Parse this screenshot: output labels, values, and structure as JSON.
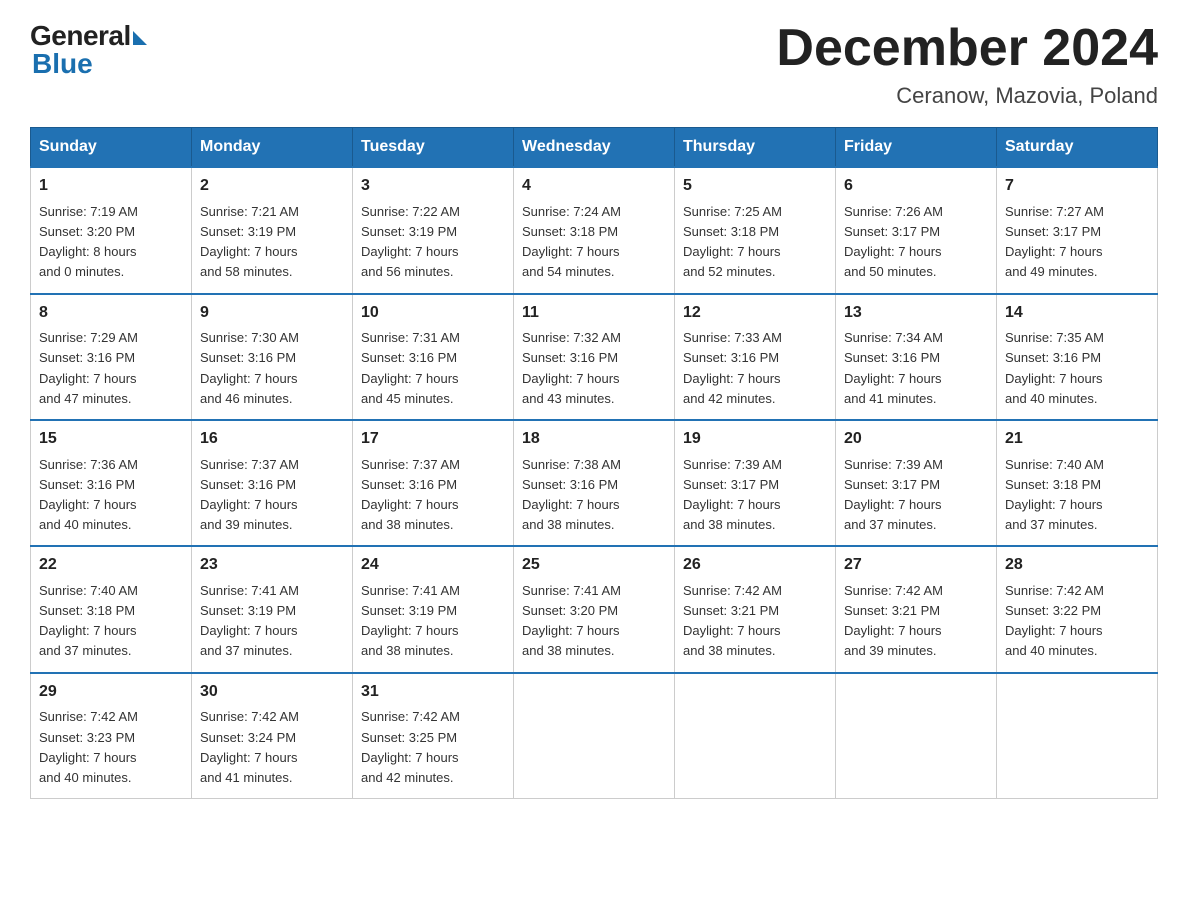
{
  "logo": {
    "general": "General",
    "blue": "Blue"
  },
  "title": "December 2024",
  "subtitle": "Ceranow, Mazovia, Poland",
  "weekdays": [
    "Sunday",
    "Monday",
    "Tuesday",
    "Wednesday",
    "Thursday",
    "Friday",
    "Saturday"
  ],
  "weeks": [
    [
      {
        "day": "1",
        "sunrise": "7:19 AM",
        "sunset": "3:20 PM",
        "daylight": "8 hours and 0 minutes."
      },
      {
        "day": "2",
        "sunrise": "7:21 AM",
        "sunset": "3:19 PM",
        "daylight": "7 hours and 58 minutes."
      },
      {
        "day": "3",
        "sunrise": "7:22 AM",
        "sunset": "3:19 PM",
        "daylight": "7 hours and 56 minutes."
      },
      {
        "day": "4",
        "sunrise": "7:24 AM",
        "sunset": "3:18 PM",
        "daylight": "7 hours and 54 minutes."
      },
      {
        "day": "5",
        "sunrise": "7:25 AM",
        "sunset": "3:18 PM",
        "daylight": "7 hours and 52 minutes."
      },
      {
        "day": "6",
        "sunrise": "7:26 AM",
        "sunset": "3:17 PM",
        "daylight": "7 hours and 50 minutes."
      },
      {
        "day": "7",
        "sunrise": "7:27 AM",
        "sunset": "3:17 PM",
        "daylight": "7 hours and 49 minutes."
      }
    ],
    [
      {
        "day": "8",
        "sunrise": "7:29 AM",
        "sunset": "3:16 PM",
        "daylight": "7 hours and 47 minutes."
      },
      {
        "day": "9",
        "sunrise": "7:30 AM",
        "sunset": "3:16 PM",
        "daylight": "7 hours and 46 minutes."
      },
      {
        "day": "10",
        "sunrise": "7:31 AM",
        "sunset": "3:16 PM",
        "daylight": "7 hours and 45 minutes."
      },
      {
        "day": "11",
        "sunrise": "7:32 AM",
        "sunset": "3:16 PM",
        "daylight": "7 hours and 43 minutes."
      },
      {
        "day": "12",
        "sunrise": "7:33 AM",
        "sunset": "3:16 PM",
        "daylight": "7 hours and 42 minutes."
      },
      {
        "day": "13",
        "sunrise": "7:34 AM",
        "sunset": "3:16 PM",
        "daylight": "7 hours and 41 minutes."
      },
      {
        "day": "14",
        "sunrise": "7:35 AM",
        "sunset": "3:16 PM",
        "daylight": "7 hours and 40 minutes."
      }
    ],
    [
      {
        "day": "15",
        "sunrise": "7:36 AM",
        "sunset": "3:16 PM",
        "daylight": "7 hours and 40 minutes."
      },
      {
        "day": "16",
        "sunrise": "7:37 AM",
        "sunset": "3:16 PM",
        "daylight": "7 hours and 39 minutes."
      },
      {
        "day": "17",
        "sunrise": "7:37 AM",
        "sunset": "3:16 PM",
        "daylight": "7 hours and 38 minutes."
      },
      {
        "day": "18",
        "sunrise": "7:38 AM",
        "sunset": "3:16 PM",
        "daylight": "7 hours and 38 minutes."
      },
      {
        "day": "19",
        "sunrise": "7:39 AM",
        "sunset": "3:17 PM",
        "daylight": "7 hours and 38 minutes."
      },
      {
        "day": "20",
        "sunrise": "7:39 AM",
        "sunset": "3:17 PM",
        "daylight": "7 hours and 37 minutes."
      },
      {
        "day": "21",
        "sunrise": "7:40 AM",
        "sunset": "3:18 PM",
        "daylight": "7 hours and 37 minutes."
      }
    ],
    [
      {
        "day": "22",
        "sunrise": "7:40 AM",
        "sunset": "3:18 PM",
        "daylight": "7 hours and 37 minutes."
      },
      {
        "day": "23",
        "sunrise": "7:41 AM",
        "sunset": "3:19 PM",
        "daylight": "7 hours and 37 minutes."
      },
      {
        "day": "24",
        "sunrise": "7:41 AM",
        "sunset": "3:19 PM",
        "daylight": "7 hours and 38 minutes."
      },
      {
        "day": "25",
        "sunrise": "7:41 AM",
        "sunset": "3:20 PM",
        "daylight": "7 hours and 38 minutes."
      },
      {
        "day": "26",
        "sunrise": "7:42 AM",
        "sunset": "3:21 PM",
        "daylight": "7 hours and 38 minutes."
      },
      {
        "day": "27",
        "sunrise": "7:42 AM",
        "sunset": "3:21 PM",
        "daylight": "7 hours and 39 minutes."
      },
      {
        "day": "28",
        "sunrise": "7:42 AM",
        "sunset": "3:22 PM",
        "daylight": "7 hours and 40 minutes."
      }
    ],
    [
      {
        "day": "29",
        "sunrise": "7:42 AM",
        "sunset": "3:23 PM",
        "daylight": "7 hours and 40 minutes."
      },
      {
        "day": "30",
        "sunrise": "7:42 AM",
        "sunset": "3:24 PM",
        "daylight": "7 hours and 41 minutes."
      },
      {
        "day": "31",
        "sunrise": "7:42 AM",
        "sunset": "3:25 PM",
        "daylight": "7 hours and 42 minutes."
      },
      null,
      null,
      null,
      null
    ]
  ],
  "labels": {
    "sunrise": "Sunrise:",
    "sunset": "Sunset:",
    "daylight": "Daylight:"
  }
}
